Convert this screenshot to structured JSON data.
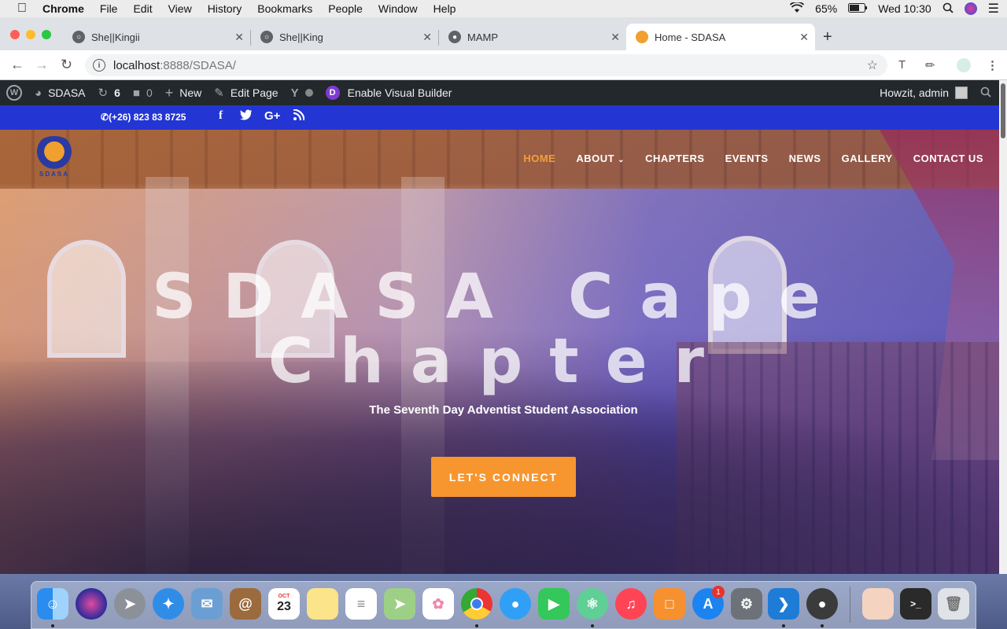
{
  "menubar": {
    "app": "Chrome",
    "items": [
      "File",
      "Edit",
      "View",
      "History",
      "Bookmarks",
      "People",
      "Window",
      "Help"
    ],
    "battery": "65%",
    "clock": "Wed 10:30"
  },
  "tabs": [
    {
      "title": "She||Kingii",
      "active": false
    },
    {
      "title": "She||King",
      "active": false
    },
    {
      "title": "MAMP",
      "active": false
    },
    {
      "title": "Home - SDASA",
      "active": true
    }
  ],
  "omnibox": {
    "host": "localhost",
    "path": ":8888/SDASA/"
  },
  "adminbar": {
    "site": "SDASA",
    "updates": "6",
    "comments": "0",
    "new": "New",
    "edit": "Edit Page",
    "visual_builder_badge": "D",
    "visual_builder": "Enable Visual Builder",
    "greeting": "Howzit, admin"
  },
  "topbar": {
    "phone": "(+26) 823 83 8725",
    "social": [
      "facebook-icon",
      "twitter-icon",
      "google-plus-icon",
      "rss-icon"
    ]
  },
  "logo": {
    "text": "SDASA"
  },
  "nav": {
    "items": [
      "HOME",
      "ABOUT",
      "CHAPTERS",
      "EVENTS",
      "NEWS",
      "GALLERY",
      "CONTACT US"
    ],
    "active": "HOME"
  },
  "hero": {
    "line1": "SDASA Cape",
    "line2": "Chapter",
    "subtitle": "The Seventh Day Adventist Student Association",
    "cta": "LET'S CONNECT"
  },
  "dock": {
    "apps": [
      "Finder",
      "Siri",
      "Launchpad",
      "Safari",
      "Mail",
      "Contacts",
      "Calendar",
      "Notes",
      "Reminders",
      "Maps",
      "Photos",
      "Chrome",
      "Messages",
      "FaceTime",
      "Atom",
      "iTunes",
      "Books",
      "App Store",
      "System Preferences",
      "VS Code",
      "MAMP",
      "Preview",
      "Terminal",
      "Trash"
    ],
    "calendar_month": "OCT",
    "calendar_day": "23",
    "appstore_badge": "1"
  },
  "colors": {
    "accent": "#f7962e",
    "topbar": "#2336d4",
    "adminbar": "#23282d"
  }
}
